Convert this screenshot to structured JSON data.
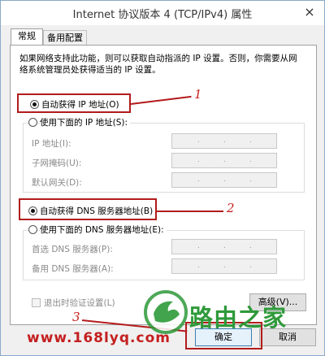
{
  "window": {
    "title": "Internet 协议版本 4 (TCP/IPv4) 属性",
    "close_glyph": "×"
  },
  "tabs": [
    {
      "label": "常规",
      "active": true
    },
    {
      "label": "备用配置",
      "active": false
    }
  ],
  "description": "如果网络支持此功能，则可以获取自动指派的 IP 设置。否则，你需要从网络系统管理员处获得适当的 IP 设置。",
  "ip": {
    "auto_label": "自动获得 IP 地址(O)",
    "auto_selected": true,
    "manual_label": "使用下面的 IP 地址(S):",
    "manual_selected": false,
    "fields": [
      {
        "label": "IP 地址(I):",
        "value": ". . ."
      },
      {
        "label": "子网掩码(U):",
        "value": ". . ."
      },
      {
        "label": "默认网关(D):",
        "value": ". . ."
      }
    ]
  },
  "dns": {
    "auto_label": "自动获得 DNS 服务器地址(B)",
    "auto_selected": true,
    "manual_label": "使用下面的 DNS 服务器地址(E):",
    "manual_selected": false,
    "fields": [
      {
        "label": "首选 DNS 服务器(P):",
        "value": ". . ."
      },
      {
        "label": "备用 DNS 服务器(A):",
        "value": ". . ."
      }
    ]
  },
  "validate_label": "退出时验证设置(L)",
  "validate_checked": false,
  "buttons": {
    "advanced": "高级(V)...",
    "ok": "确定",
    "cancel": "取消"
  },
  "annotations": [
    "1",
    "2",
    "3"
  ],
  "watermark": {
    "url": "www.168lyq.com",
    "logo_text": "路由之家"
  },
  "colors": {
    "annotation_red": "#b31b1b",
    "logo_green": "#2e9a3a"
  }
}
